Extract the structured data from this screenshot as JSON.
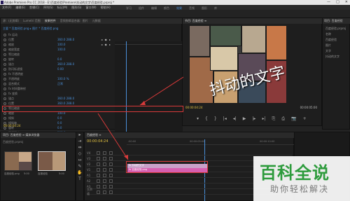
{
  "window": {
    "title": "Adobe Premiere Pro CC 2018 - E:\\百度经验\\Premiere\\抖动的文字\\百度经验.prproj *",
    "minimize": "—",
    "maximize": "□",
    "close": "✕"
  },
  "menubar": {
    "items": [
      "文件(F)",
      "编辑(E)",
      "剪辑(C)",
      "序列(S)",
      "标记(M)",
      "图形(G)",
      "窗口(W)",
      "帮助(H)"
    ],
    "workspaces": [
      "学习",
      "组件",
      "编辑",
      "颜色",
      "效果",
      "音频",
      "图形",
      "库"
    ],
    "active_workspace": "效果"
  },
  "effect_controls": {
    "tabs": [
      "源：(无剪辑)",
      "Lumetri 范围",
      "效果控件",
      "音频剪辑混合器：图片",
      "元数据"
    ],
    "active_tab": "效果控件",
    "source": "主要 * 百度经验.png ▸ 图片 * 百度经验.png",
    "rows": [
      {
        "label": "fx 运动",
        "value": "",
        "kf": ""
      },
      {
        "label": "位置",
        "value": "360.0 288.0",
        "kf": "◂ ◆ ▸"
      },
      {
        "label": "缩放",
        "value": "100.0",
        "kf": "◂ ◆ ▸"
      },
      {
        "label": "缩放宽度",
        "value": "100.0",
        "kf": ""
      },
      {
        "label": "等比缩放",
        "value": "",
        "kf": ""
      },
      {
        "label": "旋转",
        "value": "0.0",
        "kf": ""
      },
      {
        "label": "锚点",
        "value": "360.0 288.0",
        "kf": ""
      },
      {
        "label": "防闪烁滤镜",
        "value": "0.00",
        "kf": ""
      },
      {
        "label": "fx 不透明度",
        "value": "",
        "kf": ""
      },
      {
        "label": "不透明度",
        "value": "100.0 %",
        "kf": ""
      },
      {
        "label": "混合模式",
        "value": "正常",
        "kf": ""
      },
      {
        "label": "fx 时间重映射",
        "value": "",
        "kf": ""
      },
      {
        "label": "fx 变换",
        "value": "",
        "kf": ""
      },
      {
        "label": "锚点",
        "value": "360.0 288.0",
        "kf": ""
      },
      {
        "label": "位置",
        "value": "360.0 288.0",
        "kf": ""
      },
      {
        "label": "等比缩放",
        "value": "",
        "kf": ""
      },
      {
        "label": "缩放",
        "value": "100.0",
        "kf": ""
      },
      {
        "label": "倾斜",
        "value": "0.0",
        "kf": ""
      },
      {
        "label": "倾斜轴",
        "value": "0.0",
        "kf": ""
      },
      {
        "label": "旋转",
        "value": "0.0",
        "kf": ""
      },
      {
        "label": "不透明度",
        "value": "100.0",
        "kf": ""
      },
      {
        "label": "快门角度",
        "value": "0.00",
        "kf": "◂ ◆ ▸"
      },
      {
        "label": "采样",
        "value": "双线性",
        "kf": ""
      }
    ],
    "timecode": "00:00:04:24"
  },
  "program_monitor": {
    "tab": "节目: 百度经验 ≡",
    "overlay_text": "抖动的文字",
    "timecode_current": "00:00:04:24",
    "timecode_total": "00:00:05:00",
    "controls": [
      "▾",
      "{",
      "}",
      "|◂",
      "◂|",
      "▶",
      "|▸",
      "▸|",
      "⎘",
      "⎙",
      "📷",
      "+"
    ]
  },
  "project": {
    "header": "项目: 百度经验",
    "items": [
      "百度经验.prproj",
      "名称",
      "百度经验",
      "图片",
      "文字",
      "抖动的文字"
    ]
  },
  "project_bin": {
    "tabs": "项目: 百度经验 ≡  媒体浏览器",
    "path": "百度经验.prproj",
    "thumbs": [
      {
        "label": "百度经验.png",
        "time": "5:00"
      },
      {
        "label": "百度经验",
        "time": "5:00"
      }
    ]
  },
  "tools": [
    "▸",
    "⇥",
    "⇹",
    "◇",
    "↔",
    "✎",
    "✋",
    "T"
  ],
  "timeline": {
    "tab": "百度经验 ≡",
    "timecode": "00:00:04:24",
    "ruler_labels": [
      ":00:00",
      "00:00:05:00",
      "00:00:10:00"
    ],
    "tracks": [
      "V4",
      "V3",
      "V2",
      "V1",
      "A1",
      "A2",
      "A3",
      "主声道"
    ],
    "clips": [
      {
        "label": "fx 抖动的文字",
        "track": "V2"
      },
      {
        "label": "fx 百度经验.png",
        "track": "V1"
      }
    ]
  },
  "highlight": {
    "color": "#d83a3a"
  },
  "watermark": {
    "main": "百科全说",
    "sub": "助你轻松解决",
    "color": "#2d9b3c"
  }
}
